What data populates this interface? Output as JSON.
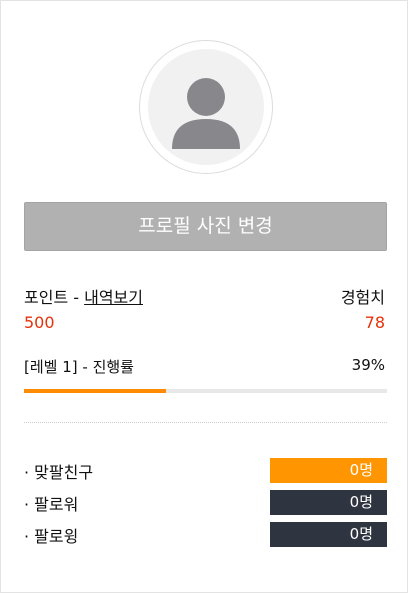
{
  "profile": {
    "change_photo_label": "프로필 사진 변경"
  },
  "points": {
    "label": "포인트 - ",
    "history_link": "내역보기",
    "value": "500"
  },
  "experience": {
    "label": "경험치",
    "value": "78"
  },
  "level": {
    "label": "[레벨 1] - 진행률",
    "progress_text": "39%",
    "progress_fraction": 0.39
  },
  "stats": [
    {
      "label": "· 맞팔친구",
      "value": "0명",
      "color": "#ff9500"
    },
    {
      "label": "· 팔로워",
      "value": "0명",
      "color": "#2e3440"
    },
    {
      "label": "· 팔로윙",
      "value": "0명",
      "color": "#2e3440"
    }
  ],
  "colors": {
    "accent": "#ff8c00",
    "value_red": "#e6320a"
  }
}
